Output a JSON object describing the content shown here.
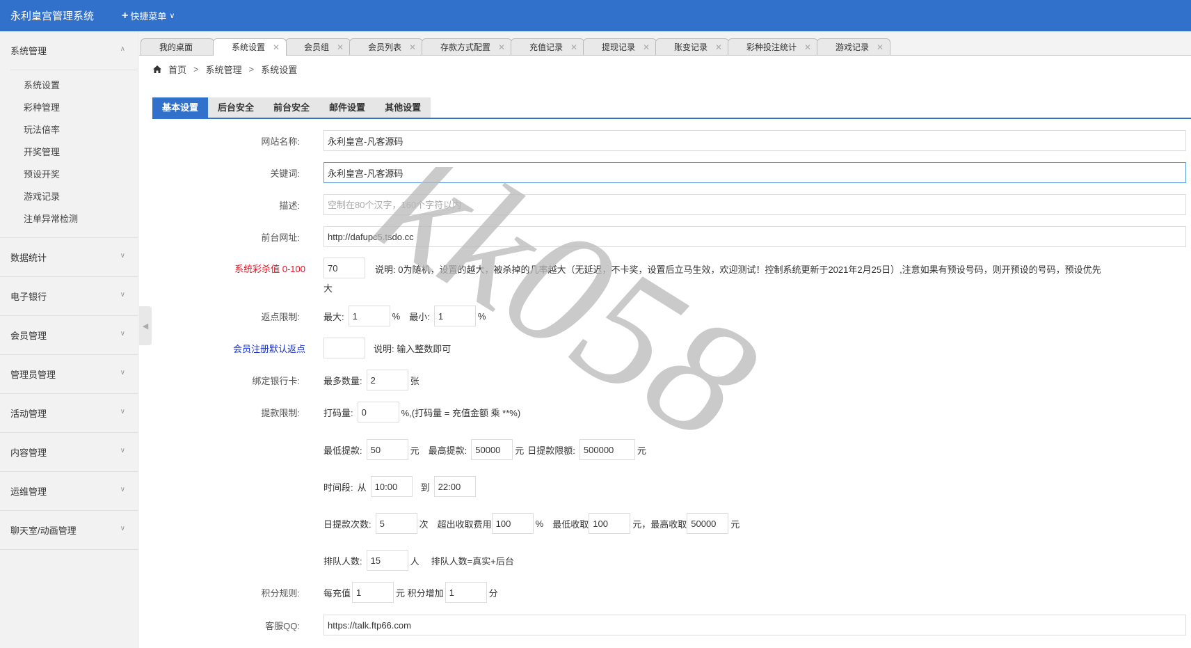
{
  "header": {
    "app_title": "永利皇宫管理系统",
    "quick_menu_label": "快捷菜单"
  },
  "sidebar": {
    "groups": [
      {
        "label": "系统管理",
        "items": [
          "系统设置",
          "彩种管理",
          "玩法倍率",
          "开奖管理",
          "预设开奖",
          "游戏记录",
          "注单异常检测"
        ]
      },
      {
        "label": "数据统计"
      },
      {
        "label": "电子银行"
      },
      {
        "label": "会员管理"
      },
      {
        "label": "管理员管理"
      },
      {
        "label": "活动管理"
      },
      {
        "label": "内容管理"
      },
      {
        "label": "运维管理"
      },
      {
        "label": "聊天室/动画管理"
      }
    ]
  },
  "tabs": [
    "我的桌面",
    "系统设置",
    "会员组",
    "会员列表",
    "存款方式配置",
    "充值记录",
    "提现记录",
    "账变记录",
    "彩种投注统计",
    "游戏记录"
  ],
  "breadcrumb": {
    "home": "首页",
    "level1": "系统管理",
    "level2": "系统设置"
  },
  "settings_tabs": [
    "基本设置",
    "后台安全",
    "前台安全",
    "邮件设置",
    "其他设置"
  ],
  "form": {
    "site_name": {
      "label": "网站名称:",
      "value": "永利皇宫-凡客源码"
    },
    "keywords": {
      "label": "关键词:",
      "value": "永利皇宫-凡客源码"
    },
    "description": {
      "label": "描述:",
      "placeholder": "空制在80个汉字，160个字符以内"
    },
    "front_url": {
      "label": "前台网址:",
      "value": "http://dafupc5.tsdo.cc"
    },
    "kill_rate": {
      "label": "系统彩杀值 0-100",
      "value": "70",
      "note": "说明:   0为随机，设置的越大，被杀掉的几率越大（无延迟，不卡奖，设置后立马生效，欢迎测试！控制系统更新于2021年2月25日）,注意如果有预设号码，则开预设的号码，预设优先",
      "note_wrap": "大"
    },
    "rebate": {
      "label": "返点限制:",
      "max_label": "最大:",
      "max": "1",
      "min_label": "最小:",
      "min": "1",
      "unit": "%"
    },
    "reg_rebate": {
      "label": "会员注册默认返点",
      "value": "",
      "note": "说明:   输入整数即可"
    },
    "bank_card": {
      "label": "绑定银行卡:",
      "max_label": "最多数量:",
      "value": "2",
      "unit": "张"
    },
    "withdraw": {
      "label": "提款限制:",
      "turnover_label": "打码量:",
      "turnover": "0",
      "turnover_note": "%,(打码量 = 充值金额 乘 **%)",
      "min_label": "最低提款:",
      "min": "50",
      "yuan": "元",
      "max_label": "最高提款:",
      "max": "50000",
      "daily_label": "日提款限额:",
      "daily": "500000",
      "time_label": "时间段:",
      "from_label": "从",
      "from": "10:00",
      "to_label": "到",
      "to": "22:00",
      "times_label": "日提款次数:",
      "times": "5",
      "times_unit": "次",
      "fee_label": "超出收取费用",
      "fee": "100",
      "fee_unit": "%",
      "fee_min_label": "最低收取",
      "fee_min": "100",
      "fee_max_label": "元，最高收取",
      "fee_max": "50000",
      "queue_label": "排队人数:",
      "queue": "15",
      "queue_unit": "人",
      "queue_note": "排队人数=真实+后台"
    },
    "points": {
      "label": "积分规则:",
      "per_label": "每充值",
      "per": "1",
      "add_label": "元 积分增加",
      "add": "1",
      "unit": "分"
    },
    "qq": {
      "label": "客服QQ:",
      "value": "https://talk.ftp66.com"
    }
  },
  "watermark": "kk058"
}
